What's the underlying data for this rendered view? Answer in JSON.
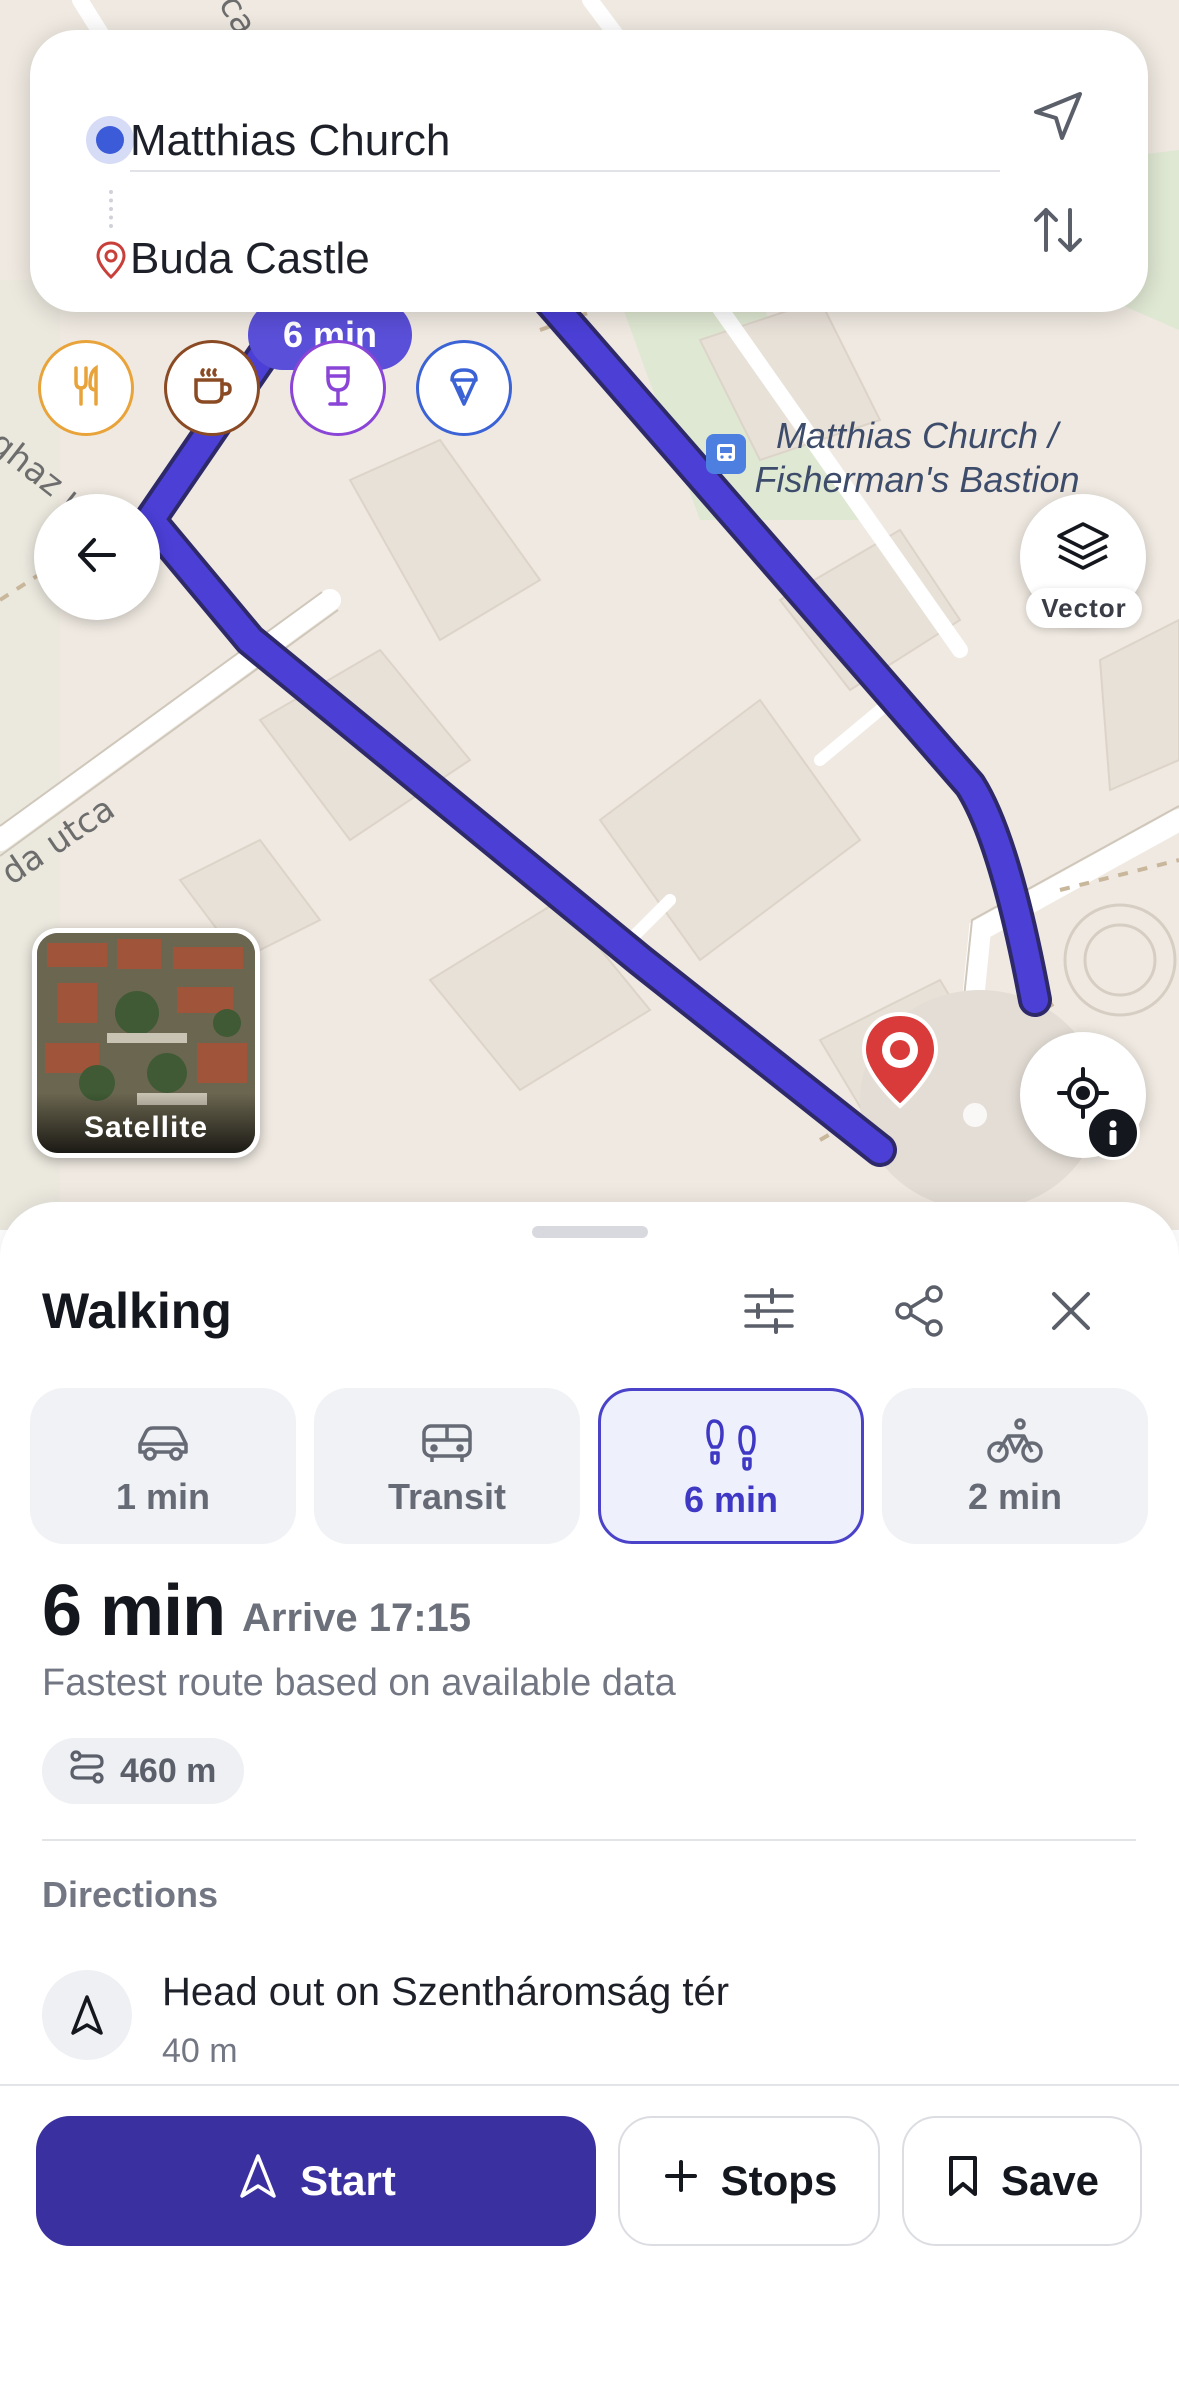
{
  "route": {
    "origin": "Matthias Church",
    "destination": "Buda Castle",
    "time_bubble": "6 min"
  },
  "map": {
    "street_labels": [
      "ca",
      "ághaz u.",
      "da utca"
    ],
    "poi_label": "Matthias Church / Fisherman's Bastion",
    "layer_label": "Vector",
    "satellite_label": "Satellite",
    "route_color": "#4b3fd6"
  },
  "chips": [
    {
      "name": "restaurant-icon",
      "color": "#e8a33b"
    },
    {
      "name": "cafe-icon",
      "color": "#8a4a24"
    },
    {
      "name": "wine-bar-icon",
      "color": "#8a45d6"
    },
    {
      "name": "ice-cream-icon",
      "color": "#3b63d6"
    }
  ],
  "sheet": {
    "title": "Walking",
    "modes": [
      {
        "icon": "car-icon",
        "label": "1 min",
        "active": false
      },
      {
        "icon": "bus-icon",
        "label": "Transit",
        "active": false
      },
      {
        "icon": "walk-icon",
        "label": "6 min",
        "active": true
      },
      {
        "icon": "bike-icon",
        "label": "2 min",
        "active": false
      }
    ],
    "duration": "6 min",
    "arrive": "Arrive 17:15",
    "subtitle": "Fastest route based on available data",
    "distance": "460 m",
    "directions_heading": "Directions",
    "steps": [
      {
        "text": "Head out on Szentháromság tér",
        "distance": "40 m"
      }
    ]
  },
  "actions": {
    "start": "Start",
    "stops": "Stops",
    "save": "Save"
  }
}
